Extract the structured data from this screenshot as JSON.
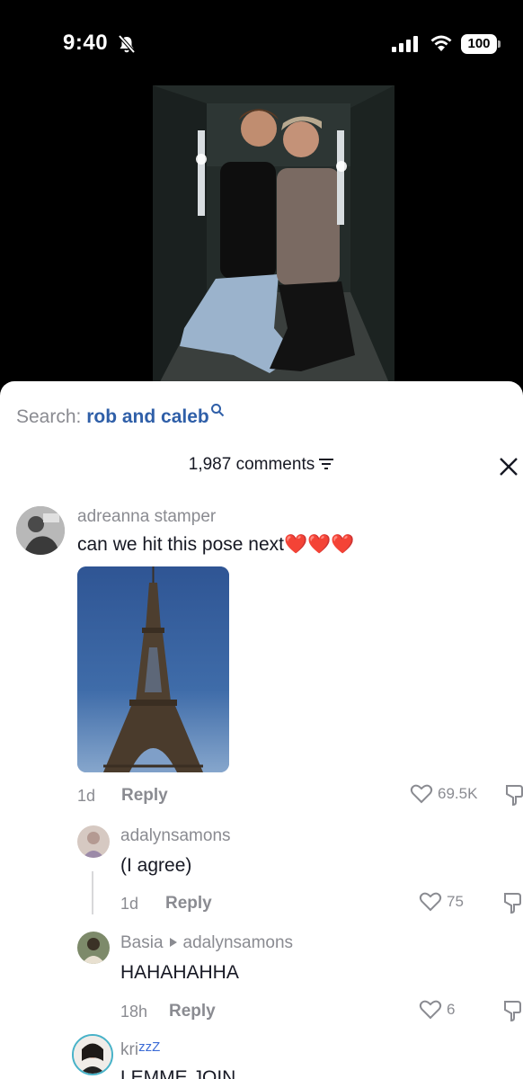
{
  "status_bar": {
    "time": "9:40",
    "battery": "100",
    "icons": [
      "bell-slash-icon",
      "signal-icon",
      "wifi-icon",
      "battery-icon"
    ]
  },
  "video": {
    "description_icons": [
      "video-frame"
    ]
  },
  "search": {
    "prefix": "Search: ",
    "query": "rob and caleb"
  },
  "comments": {
    "count_label": "1,987 comments",
    "items": [
      {
        "username": "adreanna stamper",
        "text": "can we hit this pose next❤️❤️❤️",
        "time": "1d",
        "reply_label": "Reply",
        "likes": "69.5K"
      },
      {
        "username": "adalynsamons",
        "text": "(I agree)",
        "time": "1d",
        "reply_label": "Reply",
        "likes": "75"
      },
      {
        "username": "Basia",
        "reply_to": "adalynsamons",
        "text": "HAHAHAHHA",
        "time": "18h",
        "reply_label": "Reply",
        "likes": "6"
      },
      {
        "username": "kri",
        "username_suffix": "zzZ",
        "text": "LEMME JOIN"
      }
    ]
  },
  "colors": {
    "accent_link": "#2f5fa8",
    "muted": "#8a8b91",
    "text": "#161823"
  }
}
